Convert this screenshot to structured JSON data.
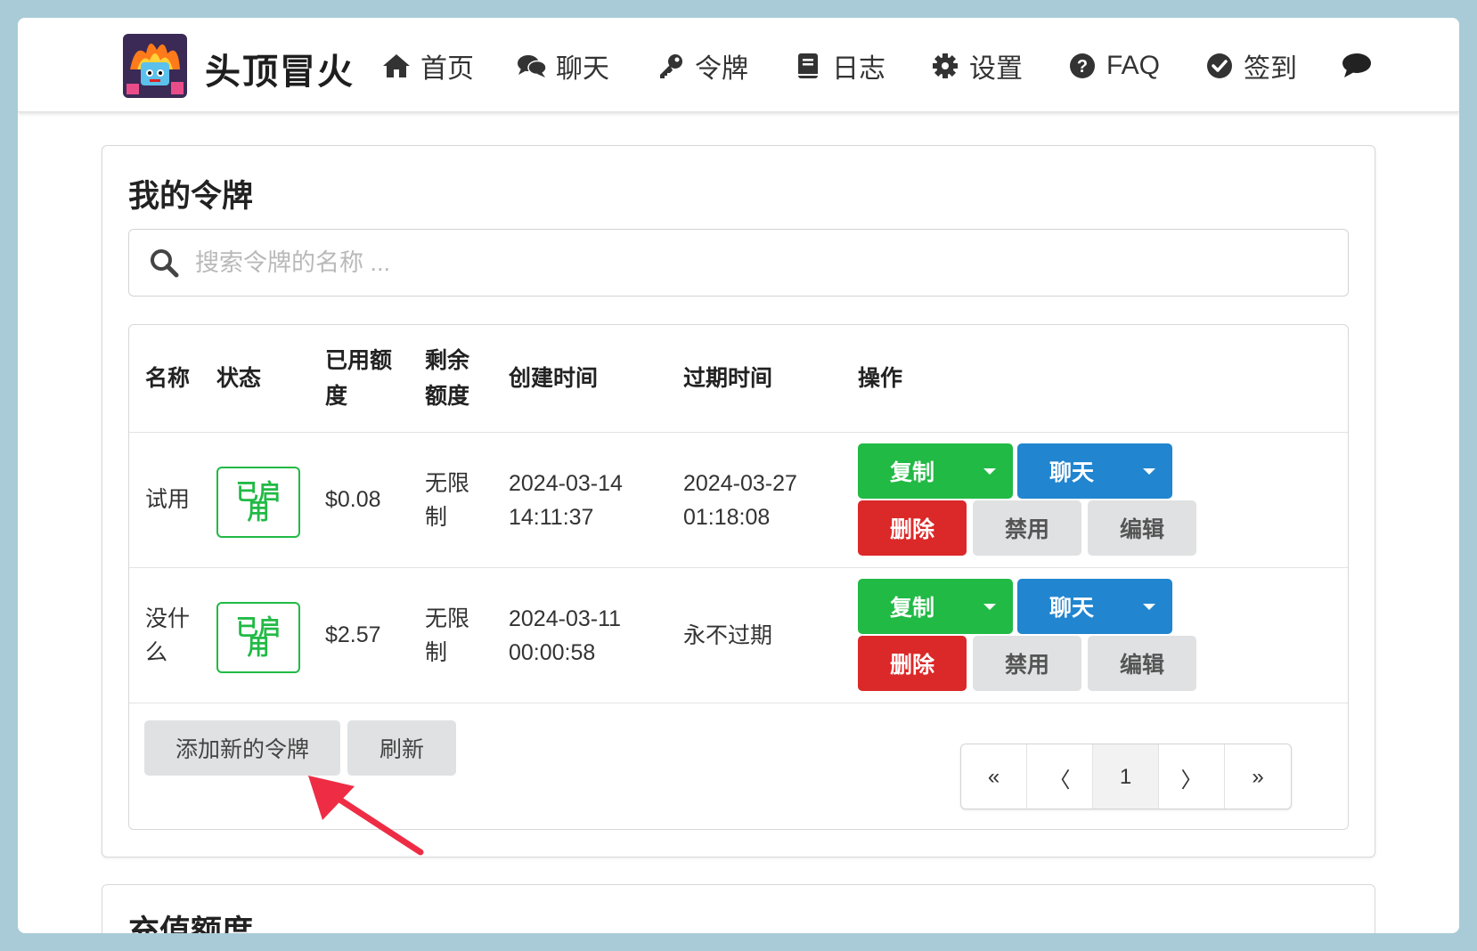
{
  "app": {
    "brand": "头顶冒火"
  },
  "nav": [
    {
      "label": "首页",
      "icon": "home-icon"
    },
    {
      "label": "聊天",
      "icon": "comments-icon"
    },
    {
      "label": "令牌",
      "icon": "key-icon"
    },
    {
      "label": "日志",
      "icon": "book-icon"
    },
    {
      "label": "设置",
      "icon": "gear-icon"
    },
    {
      "label": "FAQ",
      "icon": "question-circle-icon"
    },
    {
      "label": "签到",
      "icon": "check-circle-icon"
    }
  ],
  "tokens_card": {
    "title": "我的令牌",
    "search_placeholder": "搜索令牌的名称 ..."
  },
  "table": {
    "headers": {
      "name": "名称",
      "status": "状态",
      "used_line1": "已用额",
      "used_line2": "度",
      "remain_line1": "剩余",
      "remain_line2": "额度",
      "created": "创建时间",
      "expires": "过期时间",
      "actions": "操作"
    },
    "rows": [
      {
        "name_line1": "试用",
        "name_line2": "",
        "status_line1": "已启",
        "status_line2": "用",
        "used": "$0.08",
        "remain_line1": "无限",
        "remain_line2": "制",
        "created_date": "2024-03-14",
        "created_time": "14:11:37",
        "expires_date": "2024-03-27",
        "expires_time": "01:18:08"
      },
      {
        "name_line1": "没什",
        "name_line2": "么",
        "status_line1": "已启",
        "status_line2": "用",
        "used": "$2.57",
        "remain_line1": "无限",
        "remain_line2": "制",
        "created_date": "2024-03-11",
        "created_time": "00:00:58",
        "expires_date": "永不过期",
        "expires_time": ""
      }
    ],
    "actions": {
      "copy": "复制",
      "chat": "聊天",
      "delete": "删除",
      "disable": "禁用",
      "edit": "编辑"
    }
  },
  "footer": {
    "add_button": "添加新的令牌",
    "refresh_button": "刷新"
  },
  "pagination": {
    "first": "«",
    "prev": "〈",
    "current": "1",
    "next": "〉",
    "last": "»"
  },
  "card2": {
    "title": "充值额度"
  },
  "colors": {
    "green": "#21ba45",
    "blue": "#2185d0",
    "red": "#db2828",
    "grey": "#e0e1e2",
    "annotation_arrow": "#ee2d45"
  }
}
